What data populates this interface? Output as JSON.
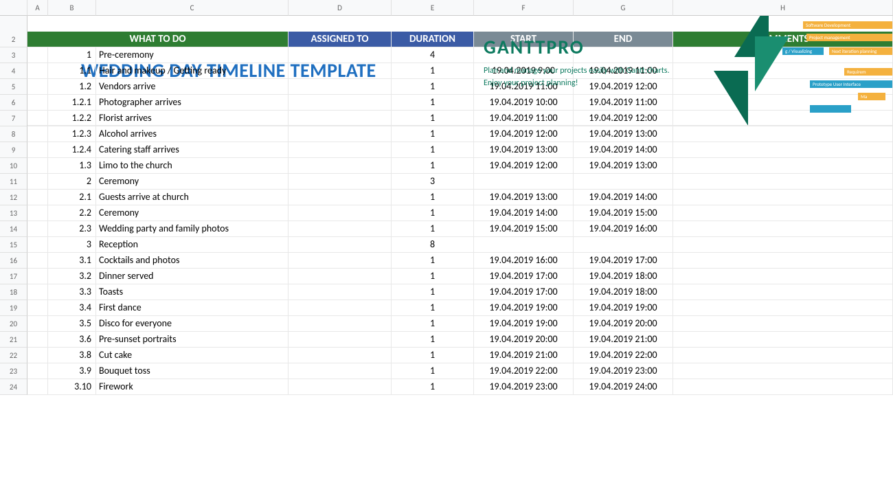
{
  "columns": [
    "",
    "A",
    "B",
    "C",
    "D",
    "E",
    "F",
    "G",
    "H"
  ],
  "banner": {
    "title": "WEDDING DAY TIMELINE TEMPLATE",
    "logo": "GANTTPRO",
    "sub1": "Plan and manage your projects easily with Gantt charts.",
    "sub2": "Enjoy your project planning!"
  },
  "headers": {
    "what": "WHAT TO DO",
    "assigned": "ASSIGNED TO",
    "duration": "DURATION",
    "start": "START",
    "end": "END",
    "comments": "COMMENTS"
  },
  "rows": [
    {
      "n": "3",
      "id": "1",
      "task": "Pre-ceremony",
      "dur": "4",
      "start": "",
      "end": ""
    },
    {
      "n": "4",
      "id": "1.1",
      "task": "Hair and makeup / Getting ready",
      "dur": "1",
      "start": "19.04.2019 9:00",
      "end": "19.04.2019 11:00"
    },
    {
      "n": "5",
      "id": "1.2",
      "task": "Vendors arrive",
      "dur": "1",
      "start": "19.04.2019 11:00",
      "end": "19.04.2019 12:00"
    },
    {
      "n": "6",
      "id": "1.2.1",
      "task": "Photographer arrives",
      "dur": "1",
      "start": "19.04.2019 10:00",
      "end": "19.04.2019 11:00"
    },
    {
      "n": "7",
      "id": "1.2.2",
      "task": "Florist arrives",
      "dur": "1",
      "start": "19.04.2019 11:00",
      "end": "19.04.2019 12:00"
    },
    {
      "n": "8",
      "id": "1.2.3",
      "task": "Alcohol arrives",
      "dur": "1",
      "start": "19.04.2019 12:00",
      "end": "19.04.2019 13:00"
    },
    {
      "n": "9",
      "id": "1.2.4",
      "task": "Catering staff arrives",
      "dur": "1",
      "start": "19.04.2019 13:00",
      "end": "19.04.2019 14:00"
    },
    {
      "n": "10",
      "id": "1.3",
      "task": "Limo to the church",
      "dur": "1",
      "start": "19.04.2019 12:00",
      "end": "19.04.2019 13:00"
    },
    {
      "n": "11",
      "id": "2",
      "task": "Ceremony",
      "dur": "3",
      "start": "",
      "end": ""
    },
    {
      "n": "12",
      "id": "2.1",
      "task": "Guests arrive at church",
      "dur": "1",
      "start": "19.04.2019 13:00",
      "end": "19.04.2019 14:00"
    },
    {
      "n": "13",
      "id": "2.2",
      "task": "Ceremony",
      "dur": "1",
      "start": "19.04.2019 14:00",
      "end": "19.04.2019 15:00"
    },
    {
      "n": "14",
      "id": "2.3",
      "task": "Wedding party and family photos",
      "dur": "1",
      "start": "19.04.2019 15:00",
      "end": "19.04.2019 16:00"
    },
    {
      "n": "15",
      "id": "3",
      "task": "Reception",
      "dur": "8",
      "start": "",
      "end": ""
    },
    {
      "n": "16",
      "id": "3.1",
      "task": "Cocktails and photos",
      "dur": "1",
      "start": "19.04.2019 16:00",
      "end": "19.04.2019 17:00"
    },
    {
      "n": "17",
      "id": "3.2",
      "task": "Dinner served",
      "dur": "1",
      "start": "19.04.2019 17:00",
      "end": "19.04.2019 18:00"
    },
    {
      "n": "18",
      "id": "3.3",
      "task": "Toasts",
      "dur": "1",
      "start": "19.04.2019 17:00",
      "end": "19.04.2019 18:00"
    },
    {
      "n": "19",
      "id": "3.4",
      "task": "First dance",
      "dur": "1",
      "start": "19.04.2019 19:00",
      "end": "19.04.2019 19:00"
    },
    {
      "n": "20",
      "id": "3.5",
      "task": "Disco for everyone",
      "dur": "1",
      "start": "19.04.2019 19:00",
      "end": "19.04.2019 20:00"
    },
    {
      "n": "21",
      "id": "3.6",
      "task": "Pre-sunset portraits",
      "dur": "1",
      "start": "19.04.2019 20:00",
      "end": "19.04.2019 21:00"
    },
    {
      "n": "22",
      "id": "3.8",
      "task": "Cut cake",
      "dur": "1",
      "start": "19.04.2019 21:00",
      "end": "19.04.2019 22:00"
    },
    {
      "n": "23",
      "id": "3.9",
      "task": "Bouquet toss",
      "dur": "1",
      "start": "19.04.2019 22:00",
      "end": "19.04.2019 23:00"
    },
    {
      "n": "24",
      "id": "3.10",
      "task": "Firework",
      "dur": "1",
      "start": "19.04.2019 23:00",
      "end": "19.04.2019 24:00"
    }
  ]
}
